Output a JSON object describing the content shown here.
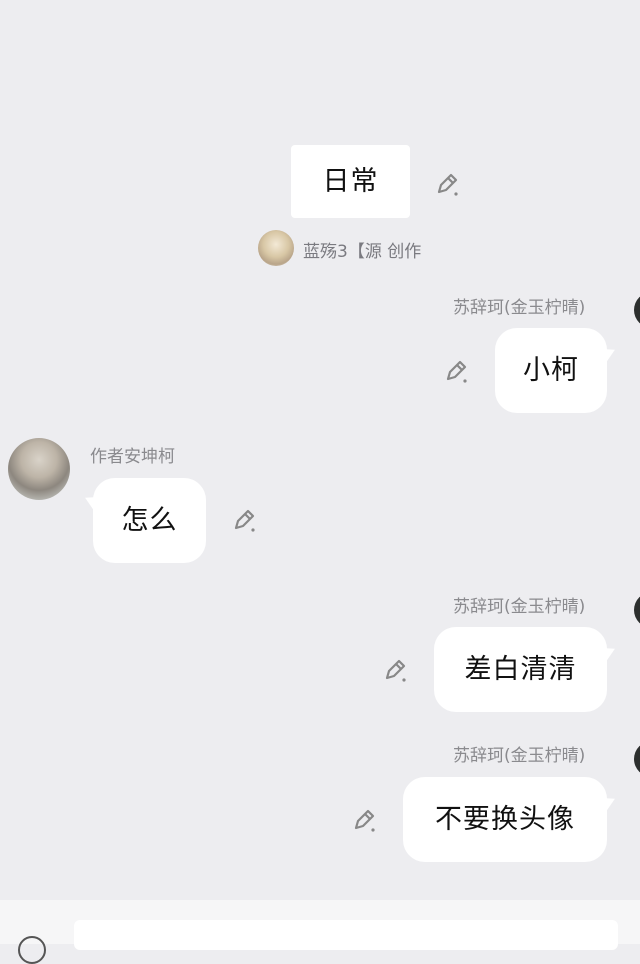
{
  "messages": [
    {
      "id": "m1",
      "type": "system",
      "text": "日常",
      "author": "蓝殇3【源 创作"
    },
    {
      "id": "m2",
      "type": "right",
      "author": "苏辞珂(金玉柠晴)",
      "text": "小柯"
    },
    {
      "id": "m3",
      "type": "left",
      "author": "作者安坤柯",
      "text": "怎么"
    },
    {
      "id": "m4",
      "type": "right",
      "author": "苏辞珂(金玉柠晴)",
      "text": "差白清清"
    },
    {
      "id": "m5",
      "type": "right",
      "author": "苏辞珂(金玉柠晴)",
      "text": "不要换头像"
    }
  ],
  "icons": {
    "edit": "edit-pencil-icon"
  },
  "colors": {
    "background": "#ededf0",
    "bubble": "#ffffff",
    "name_text": "#8a8a8e"
  }
}
